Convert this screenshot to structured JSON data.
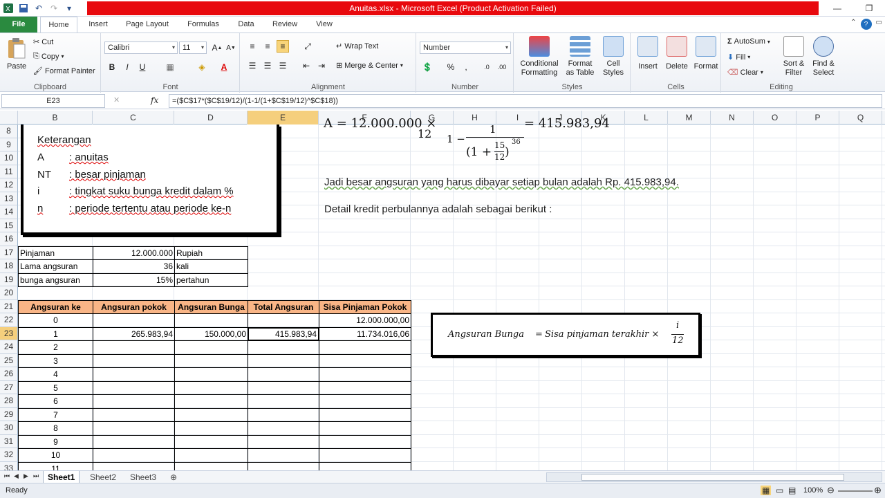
{
  "window": {
    "title": "Anuitas.xlsx - Microsoft Excel (Product Activation Failed)"
  },
  "tabs": [
    "File",
    "Home",
    "Insert",
    "Page Layout",
    "Formulas",
    "Data",
    "Review",
    "View"
  ],
  "ribbon": {
    "clipboard": {
      "paste": "Paste",
      "cut": "Cut",
      "copy": "Copy",
      "format_painter": "Format Painter",
      "label": "Clipboard"
    },
    "font": {
      "name": "Calibri",
      "size": "11",
      "label": "Font"
    },
    "alignment": {
      "wrap": "Wrap Text",
      "merge": "Merge & Center",
      "label": "Alignment"
    },
    "number": {
      "format": "Number",
      "label": "Number"
    },
    "styles": {
      "conditional": "Conditional\nFormatting",
      "format_table": "Format\nas Table",
      "cell_styles": "Cell\nStyles",
      "label": "Styles"
    },
    "cells": {
      "insert": "Insert",
      "delete": "Delete",
      "format": "Format",
      "label": "Cells"
    },
    "editing": {
      "autosum": "AutoSum",
      "fill": "Fill",
      "clear": "Clear",
      "sort": "Sort &\nFilter",
      "find": "Find &\nSelect",
      "label": "Editing"
    }
  },
  "formula_bar": {
    "name_box": "E23",
    "fx": "fx",
    "formula": "=($C$17*($C$19/12)/(1-1/(1+$C$19/12)^$C$18))"
  },
  "columns": [
    "B",
    "C",
    "D",
    "E",
    "F",
    "G",
    "H",
    "I",
    "J",
    "K",
    "L",
    "M",
    "N",
    "O",
    "P",
    "Q"
  ],
  "rows": [
    "8",
    "9",
    "10",
    "11",
    "12",
    "13",
    "14",
    "15",
    "16",
    "17",
    "18",
    "19",
    "20",
    "21",
    "22",
    "23",
    "24",
    "25",
    "26",
    "27",
    "28",
    "29",
    "30",
    "31",
    "32",
    "33"
  ],
  "keterangan": {
    "title": "Keterangan",
    "lines": [
      {
        "sym": "A",
        "desc": ": anuitas"
      },
      {
        "sym": "NT",
        "desc": ": besar pinjaman"
      },
      {
        "sym": "i",
        "desc": ": tingkat suku bunga kredit dalam %"
      },
      {
        "sym": "n",
        "desc": ": periode tertentu atau periode ke-n"
      }
    ]
  },
  "math": {
    "top_line": "A = 12.000.000 ×",
    "frac_num": "15",
    "frac_den": "12",
    "one_minus": "1 −",
    "one": "1",
    "result": "= 415.983,94",
    "exp": "36",
    "paren_open": "(1 +",
    "paren_close": ")"
  },
  "sentences": {
    "s1": "Jadi besar angsuran yang harus dibayar setiap bulan adalah Rp. 415.983,94.",
    "s2": "Detail kredit perbulannya adalah sebagai berikut :"
  },
  "params": [
    {
      "label": "Pinjaman",
      "value": "12.000.000",
      "unit": "Rupiah"
    },
    {
      "label": "Lama angsuran",
      "value": "36",
      "unit": "kali"
    },
    {
      "label": "bunga angsuran",
      "value": "15%",
      "unit": "pertahun"
    }
  ],
  "table": {
    "headers": [
      "Angsuran ke",
      "Angsuran pokok",
      "Angsuran Bunga",
      "Total Angsuran",
      "Sisa Pinjaman Pokok"
    ],
    "row0": {
      "n": "0",
      "sisa": "12.000.000,00"
    },
    "row1": {
      "n": "1",
      "pokok": "265.983,94",
      "bunga": "150.000,00",
      "total": "415.983,94",
      "sisa": "11.734.016,06"
    },
    "numbers": [
      "2",
      "3",
      "4",
      "5",
      "6",
      "7",
      "8",
      "9",
      "10",
      "11"
    ]
  },
  "formula_box": {
    "lhs": "Angsuran Bunga",
    "eq": "=",
    "rhs": "Sisa pinjaman terakhir ×",
    "num": "i",
    "den": "12"
  },
  "sheets": [
    "Sheet1",
    "Sheet2",
    "Sheet3"
  ],
  "status": {
    "ready": "Ready",
    "zoom": "100%"
  }
}
